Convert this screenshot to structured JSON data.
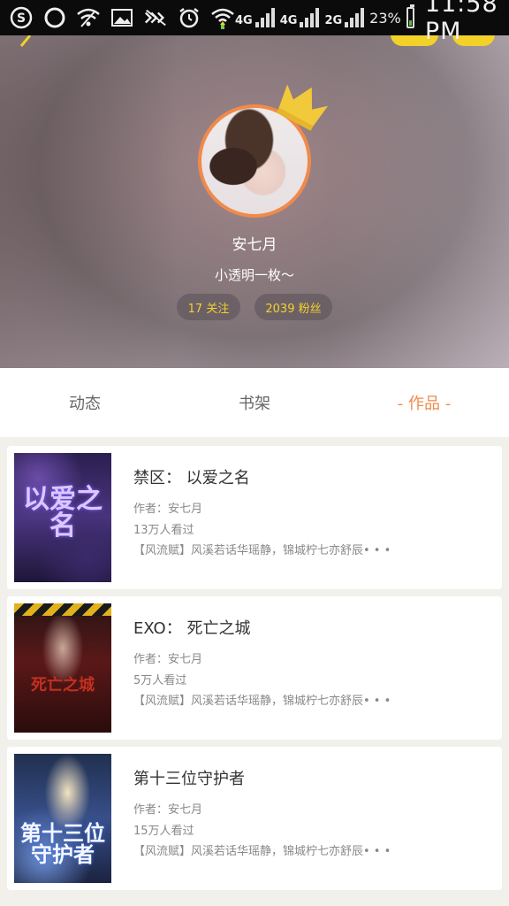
{
  "status_bar": {
    "networks": [
      "4G",
      "4G",
      "2G"
    ],
    "battery_percent": "23%",
    "time": "11:58 PM",
    "icons": [
      "s-logo-icon",
      "circle-icon",
      "wifi-off-icon",
      "image-icon",
      "mute-icon",
      "alarm-icon",
      "wifi-icon"
    ]
  },
  "profile": {
    "username": "安七月",
    "bio": "小透明一枚～",
    "following": "17 关注",
    "fans": "2039 粉丝"
  },
  "tabs": [
    {
      "label": "动态",
      "active": false
    },
    {
      "label": "书架",
      "active": false
    },
    {
      "label": "- 作品 -",
      "active": true
    }
  ],
  "works": [
    {
      "title": "禁区： 以爱之名",
      "author": "作者：安七月",
      "views": "13万人看过",
      "summary": "【风流赋】风溪若话华瑶静，锦城柠七亦舒辰• • •",
      "cover_text": "以爱之名"
    },
    {
      "title": "EXO： 死亡之城",
      "author": "作者：安七月",
      "views": "5万人看过",
      "summary": "【风流赋】风溪若话华瑶静，锦城柠七亦舒辰• • •",
      "cover_text": "死亡之城"
    },
    {
      "title": "第十三位守护者",
      "author": "作者：安七月",
      "views": "15万人看过",
      "summary": "【风流赋】风溪若话华瑶静，锦城柠七亦舒辰• • •",
      "cover_text": "第十三位守护者"
    }
  ],
  "colors": {
    "accent": "#f08a4b",
    "stat_text": "#f4d130",
    "crown": "#f2c93a"
  }
}
